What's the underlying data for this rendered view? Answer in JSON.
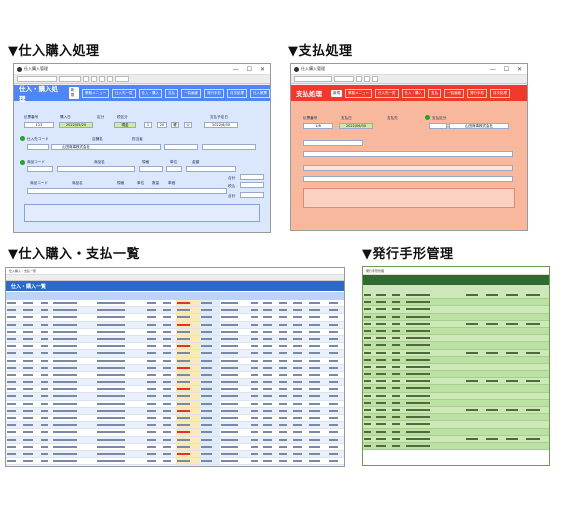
{
  "headings": {
    "purchase": "▼仕入購入処理",
    "payment": "▼支払処理",
    "list": "▼仕入購入・支払一覧",
    "notes": "▼発行手形管理"
  },
  "colors": {
    "purchase_header": "#4f86f7",
    "purchase_body": "#dbe7fd",
    "payment_header": "#f0392b",
    "payment_body": "#f8b89d",
    "list_header": "#2f69c8",
    "notes_header": "#2e6b2e",
    "notes_row": "#bde0a4"
  },
  "purchase_win": {
    "title": "仕入購入管理",
    "header_title": "仕入・購入処理",
    "badge": "新規",
    "nav": [
      "業務メニュー",
      "仕入先一覧",
      "仕入・購入",
      "支払",
      "一覧画面",
      "発行手形",
      "月次処理",
      "仕入帳票"
    ],
    "labels": {
      "invoice_no": "伝票番号",
      "purchase_date": "購入日",
      "class": "区分",
      "tax_class": "税区分",
      "year": "年",
      "month": "月",
      "day": "日",
      "week": "曜",
      "close_date": "支払予定日",
      "supplier_code": "仕入先コード",
      "branch": "店舗名",
      "contact": "担当者",
      "product_code": "商品コード",
      "product_name": "商品名",
      "spec": "規格",
      "unit": "単位",
      "qty": "数量",
      "price": "単価",
      "amount": "金額",
      "subtotal": "合計",
      "tax": "税込",
      "total": "合計"
    },
    "values": {
      "invoice_no": "123",
      "purchase_date": "2022/05/20",
      "class": "現金",
      "y": "1",
      "m": "20",
      "d": "曜",
      "w": "火",
      "close_date": "2022/6/30",
      "supplier": "山田商事株式会社"
    }
  },
  "payment_win": {
    "title": "仕入購入管理",
    "header_title": "支払処理",
    "badge": "新規",
    "nav": [
      "業務メニュー",
      "仕入先一覧",
      "仕入・購入",
      "支払",
      "一覧画面",
      "発行手形",
      "月次処理",
      "仕入帳票"
    ],
    "labels": {
      "invoice_no": "伝票番号",
      "pay_date": "支払日",
      "payee": "支払先",
      "method": "支払区分"
    },
    "values": {
      "invoice_no": "1/8",
      "pay_date": "2022/06/30",
      "supplier": "山田商事株式会社"
    }
  },
  "list_win": {
    "title": "仕入購入・支払一覧",
    "header_title": "仕入・購入一覧",
    "rows": 24
  },
  "notes_win": {
    "title": "発行手形管理",
    "rows": 22
  }
}
